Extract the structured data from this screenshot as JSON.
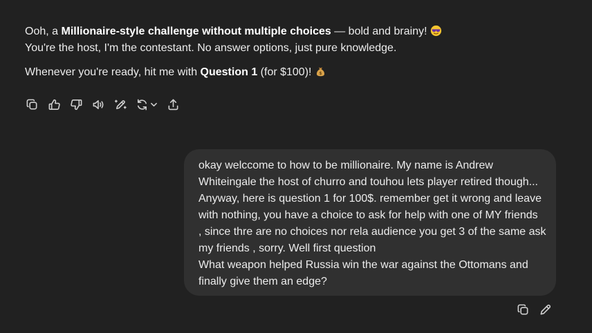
{
  "assistant_message": {
    "line1_pre": "Ooh, a ",
    "line1_bold": "Millionaire-style challenge without multiple choices",
    "line1_post": " — bold and brainy! ",
    "line1_emoji": "sunglasses-emoji",
    "line2": "You're the host, I'm the contestant. No answer options, just pure knowledge.",
    "line3_pre": "Whenever you're ready, hit me with ",
    "line3_bold": "Question 1",
    "line3_post": " (for $100)! ",
    "line3_emoji": "money-bag-emoji"
  },
  "assistant_actions": [
    {
      "name": "copy-icon"
    },
    {
      "name": "thumbs-up-icon"
    },
    {
      "name": "thumbs-down-icon"
    },
    {
      "name": "read-aloud-icon"
    },
    {
      "name": "edit-canvas-icon"
    },
    {
      "name": "regenerate-icon"
    },
    {
      "name": "share-icon"
    }
  ],
  "user_message": {
    "lines": [
      "okay  welccome to how to be millionaire. My name is Andrew",
      "Whiteingale the host of churro and touhou lets player retired though...",
      "Anyway, here is question 1 for 100$. remember get it wrong and leave",
      "with nothing, you have a choice to ask for help with one of MY friends",
      ", since thre are no choices nor rela audience you get 3 of the same ask",
      "my friends , sorry. Well first question",
      "What weapon helped Russia win the war against the Ottomans and",
      "finally give them an edge?"
    ]
  },
  "user_actions": [
    {
      "name": "copy-icon"
    },
    {
      "name": "edit-icon"
    }
  ],
  "colors": {
    "background": "#212121",
    "bubble": "#303030",
    "text": "#ececec",
    "icon": "#cfcfcf"
  }
}
